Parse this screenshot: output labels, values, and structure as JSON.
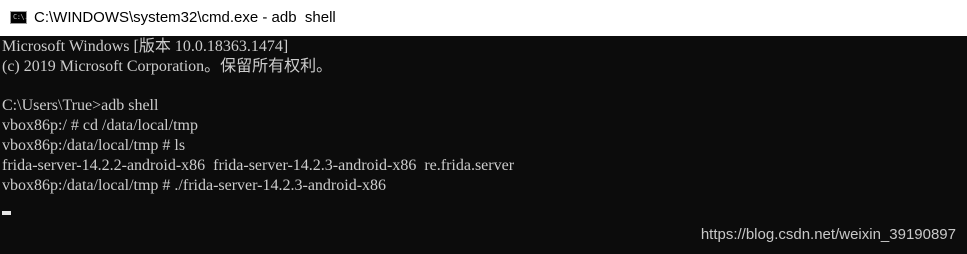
{
  "window": {
    "title": "C:\\WINDOWS\\system32\\cmd.exe - adb  shell",
    "icon": "cmd-icon",
    "icon_glyph": "C:\\."
  },
  "console": {
    "lines": [
      "Microsoft Windows [版本 10.0.18363.1474]",
      "(c) 2019 Microsoft Corporation。保留所有权利。",
      "",
      "C:\\Users\\True>adb shell",
      "vbox86p:/ # cd /data/local/tmp",
      "vbox86p:/data/local/tmp # ls",
      "frida-server-14.2.2-android-x86  frida-server-14.2.3-android-x86  re.frida.server",
      "vbox86p:/data/local/tmp # ./frida-server-14.2.3-android-x86"
    ],
    "colors": {
      "background": "#0c0c0c",
      "text": "#cccccc"
    }
  },
  "watermark": "https://blog.csdn.net/weixin_39190897"
}
